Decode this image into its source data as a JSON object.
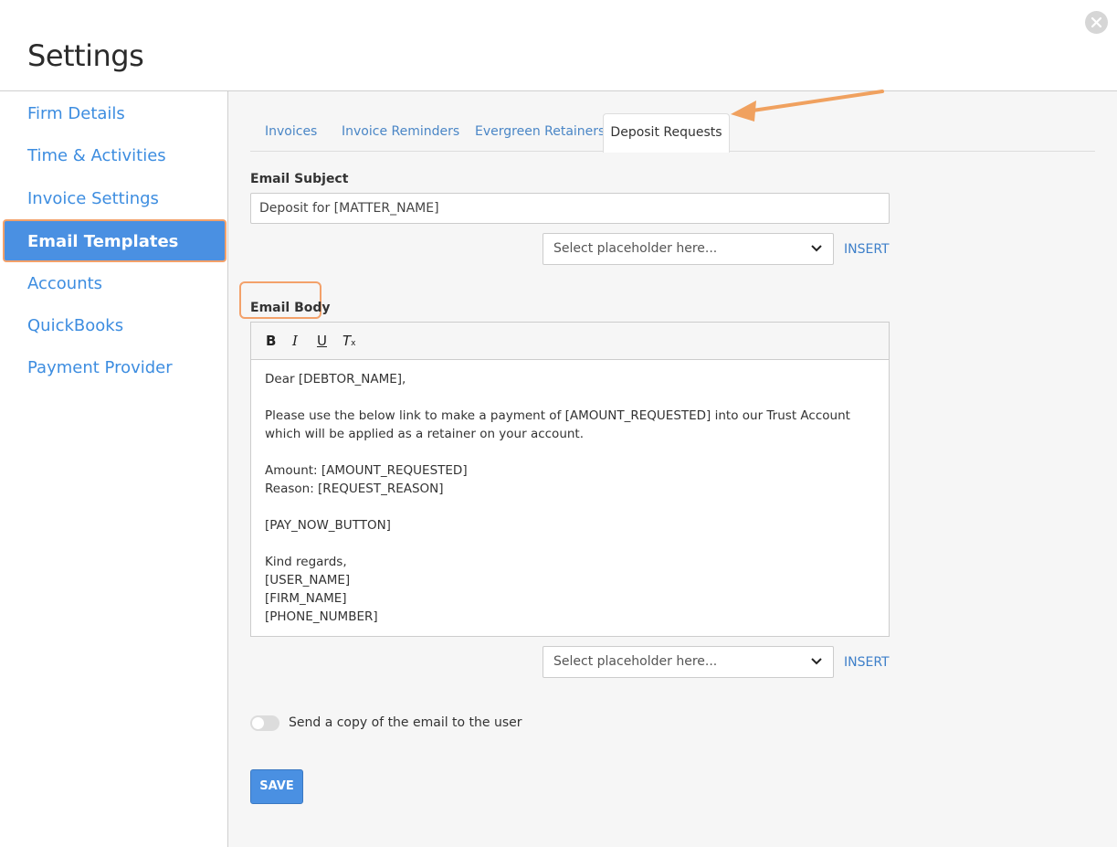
{
  "window": {
    "title": "Settings"
  },
  "sidebar": {
    "items": [
      {
        "label": "Firm Details"
      },
      {
        "label": "Time & Activities"
      },
      {
        "label": "Invoice Settings"
      },
      {
        "label": "Email Templates",
        "active": true
      },
      {
        "label": "Accounts"
      },
      {
        "label": "QuickBooks"
      },
      {
        "label": "Payment Provider"
      }
    ]
  },
  "tabs": [
    {
      "label": "Invoices"
    },
    {
      "label": "Invoice Reminders"
    },
    {
      "label": "Evergreen Retainers"
    },
    {
      "label": "Deposit Requests",
      "active": true
    }
  ],
  "subject": {
    "label": "Email Subject",
    "value": "Deposit for [MATTER_NAME]",
    "placeholder_select": "Select placeholder here...",
    "insert_label": "INSERT"
  },
  "body": {
    "label": "Email Body",
    "toolbar": {
      "bold": "B",
      "italic": "I",
      "underline": "U",
      "clear": "T"
    },
    "lines": [
      "Dear [DEBTOR_NAME],",
      "",
      "Please use the below link to make a payment of [AMOUNT_REQUESTED] into our Trust Account which will be applied as a retainer on your account.",
      "",
      "Amount: [AMOUNT_REQUESTED]",
      "Reason: [REQUEST_REASON]",
      "",
      "[PAY_NOW_BUTTON]",
      "",
      "Kind regards,",
      "[USER_NAME]",
      "[FIRM_NAME]",
      "[PHONE_NUMBER]"
    ],
    "placeholder_select": "Select placeholder here...",
    "insert_label": "INSERT"
  },
  "copy_toggle": {
    "label": "Send a copy of the email to the user",
    "on": false
  },
  "save": {
    "label": "SAVE"
  },
  "colors": {
    "accent": "#4a90e2",
    "highlight": "#f3a16a",
    "link": "#3d8de0"
  }
}
